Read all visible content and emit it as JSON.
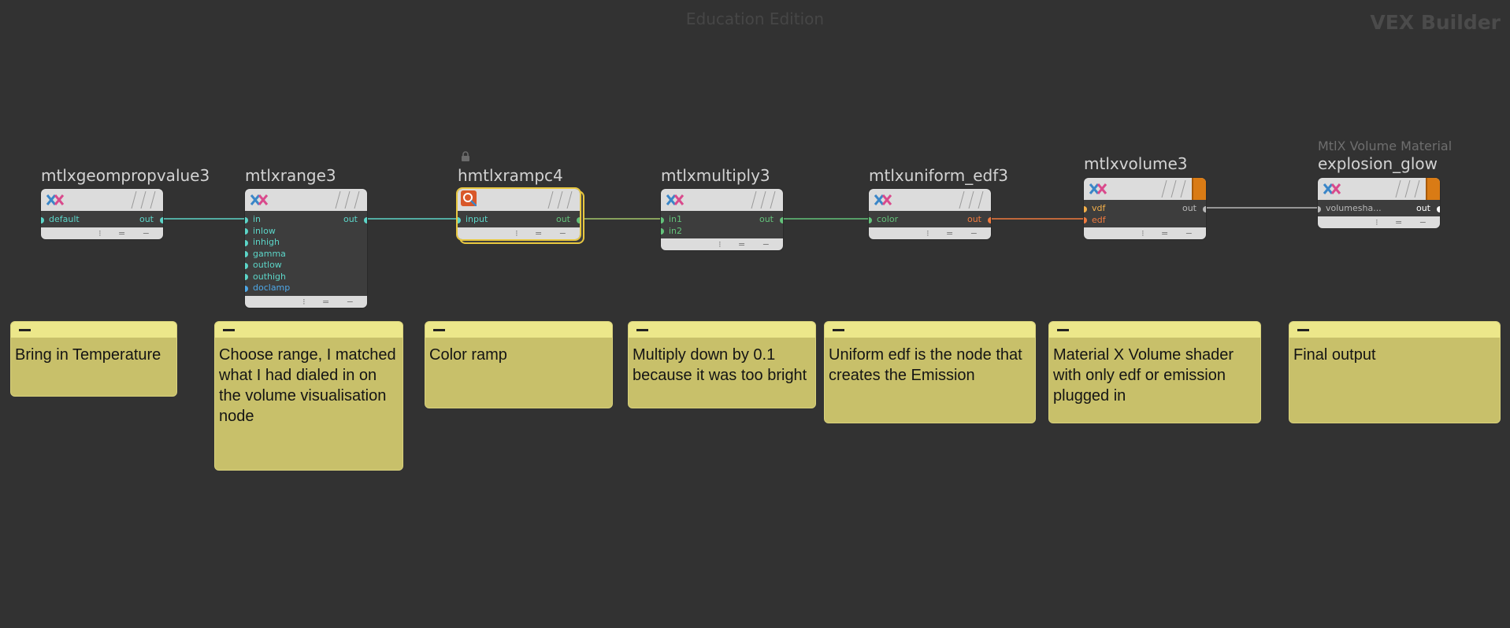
{
  "watermark": "Education Edition",
  "context_label": "VEX Builder",
  "colors": {
    "background": "#323232",
    "port_float": "#5cd5c8",
    "port_color": "#63c27a",
    "port_bool": "#4ea8e8",
    "port_edf": "#f07a3e",
    "port_vdf": "#f4b04a",
    "port_shader": "#b8b8b8",
    "sticky": "#c8c06a",
    "selection": "#e8c840",
    "material_flag": "#d97b15"
  },
  "nodes": {
    "geomprop": {
      "title": "mtlxgeompropvalue3",
      "inputs": [
        "default"
      ],
      "output": "out",
      "icon": "materialx-icon"
    },
    "range": {
      "title": "mtlxrange3",
      "inputs": [
        "in",
        "inlow",
        "inhigh",
        "gamma",
        "outlow",
        "outhigh",
        "doclamp"
      ],
      "output": "out",
      "icon": "materialx-icon"
    },
    "ramp": {
      "title": "hmtlxrampc4",
      "inputs": [
        "input"
      ],
      "output": "out",
      "icon": "houdini-materialx-icon",
      "locked": true,
      "selected": true
    },
    "multiply": {
      "title": "mtlxmultiply3",
      "inputs": [
        "in1",
        "in2"
      ],
      "output": "out",
      "icon": "materialx-icon"
    },
    "edf": {
      "title": "mtlxuniform_edf3",
      "inputs": [
        "color"
      ],
      "output": "out",
      "icon": "materialx-icon"
    },
    "volume": {
      "title": "mtlxvolume3",
      "inputs": [
        "vdf",
        "edf"
      ],
      "output": "out",
      "icon": "materialx-icon"
    },
    "material": {
      "subtitle": "MtlX Volume Material",
      "title": "explosion_glow",
      "inputs": [
        "volumesha..."
      ],
      "output": "out",
      "icon": "materialx-icon"
    }
  },
  "stickies": [
    {
      "text": "Bring in Temperature"
    },
    {
      "text": "Choose range, I matched what I had dialed in on the volume visualisation node"
    },
    {
      "text": "Color ramp"
    },
    {
      "text": "Multiply down by 0.1 because it was too bright"
    },
    {
      "text": "Uniform edf is the node that creates the Emission"
    },
    {
      "text": "Material X Volume shader with only edf or emission plugged in"
    },
    {
      "text": "Final output"
    }
  ]
}
